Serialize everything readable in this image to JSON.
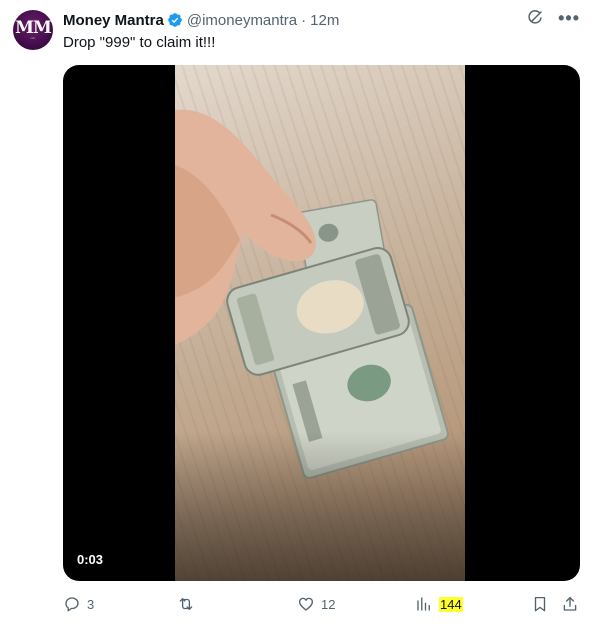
{
  "author": {
    "name": "Money Mantra",
    "handle": "@imoneymantra",
    "separator": "·",
    "time": "12m",
    "avatar_text": "MM",
    "verified_color": "#1d9bf0"
  },
  "tweet": {
    "text": "Drop \"999\" to claim it!!!"
  },
  "media": {
    "type": "video",
    "duration": "0:03"
  },
  "actions": {
    "replies": "3",
    "retweets": "",
    "likes": "12",
    "views": "144"
  },
  "icons": {
    "grok": "grok-icon",
    "more": "more-icon",
    "reply": "reply-icon",
    "retweet": "retweet-icon",
    "like": "heart-icon",
    "views": "views-icon",
    "bookmark": "bookmark-icon",
    "share": "share-icon"
  }
}
